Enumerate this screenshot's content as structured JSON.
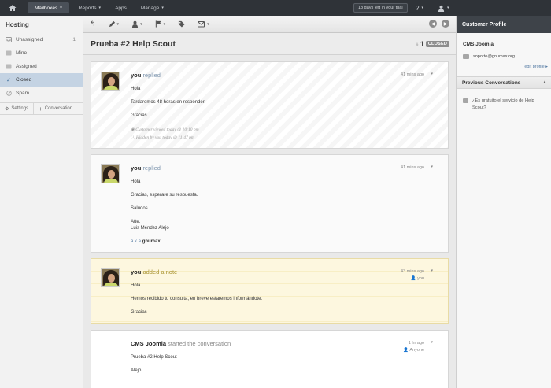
{
  "topnav": {
    "items": [
      {
        "label": "Mailboxes",
        "active": true,
        "caret": "▾"
      },
      {
        "label": "Reports",
        "caret": "▾"
      },
      {
        "label": "Apps"
      },
      {
        "label": "Manage",
        "caret": "▾"
      }
    ],
    "trial": "18 days left in your trial",
    "help": "?",
    "help_caret": "▾",
    "user_caret": "▾"
  },
  "sidebar": {
    "title": "Hosting",
    "items": [
      {
        "label": "Unassigned",
        "count": "1",
        "icon": "inbox-icon"
      },
      {
        "label": "Mine",
        "icon": "person-icon"
      },
      {
        "label": "Assigned",
        "icon": "people-icon"
      },
      {
        "label": "Closed",
        "icon": "check-icon",
        "active": true
      },
      {
        "label": "Spam",
        "icon": "ban-icon"
      }
    ],
    "settings": "Settings",
    "new_conversation": "Conversation"
  },
  "ticket": {
    "title": "Prueba #2 Help Scout",
    "hash": "#",
    "number": "1",
    "status": "CLOSED"
  },
  "threads": [
    {
      "who": "you",
      "action": "replied",
      "time": "41 mins ago",
      "lines": [
        "Hola",
        "Tardaremos 48 horas en responder.",
        "Gracias"
      ],
      "meta": [
        "Customer viewed today @ 10:10 pm",
        "Hidden by you today @ 11:47 pm"
      ]
    },
    {
      "who": "you",
      "action": "replied",
      "time": "41 mins ago",
      "lines": [
        "Hola",
        "Gracias, esperare su respuesta.",
        "Saludos"
      ],
      "sig1": "Atte.",
      "sig2": "Luis Méndez Alejo",
      "aka": "a.k.a",
      "aka_name": "gnumax"
    },
    {
      "who": "you",
      "action": "added a note",
      "time": "43 mins ago",
      "assignee": "you",
      "lines": [
        "Hola",
        "Hemos recibido tu consulta, en breve estaremos informándote.",
        "Gracias"
      ]
    },
    {
      "who": "CMS Joomla",
      "action": "started the conversation",
      "time": "1 hr ago",
      "assignee": "Anyone",
      "lines": [
        "Prueba #2 Help Scout",
        "Alejo"
      ]
    }
  ],
  "profile": {
    "header": "Customer Profile",
    "name": "CMS Joomla",
    "email": "soporte@gnumax.org",
    "edit": "edit profile",
    "edit_caret": "▸",
    "prev_header": "Previous Conversations",
    "prev_item": "¿Es gratuito el servicio de Help Scout?"
  }
}
